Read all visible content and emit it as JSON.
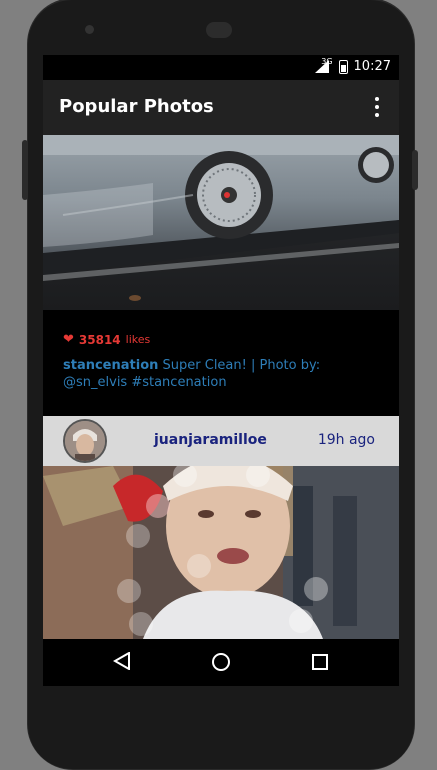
{
  "status_bar": {
    "network": "3G",
    "time": "10:27"
  },
  "app_bar": {
    "title": "Popular Photos",
    "menu_icon": "overflow-menu-icon"
  },
  "post1": {
    "likes_count": "35814",
    "likes_label": "likes",
    "caption_user": "stancenation",
    "caption_text": " Super Clean! | Photo by: @sn_elvis #stancenation"
  },
  "post2": {
    "username": "juanjaramilloe",
    "time_ago": "19h ago"
  },
  "nav_bar": {
    "back_icon": "back-icon",
    "home_icon": "home-icon",
    "recents_icon": "recents-icon"
  }
}
